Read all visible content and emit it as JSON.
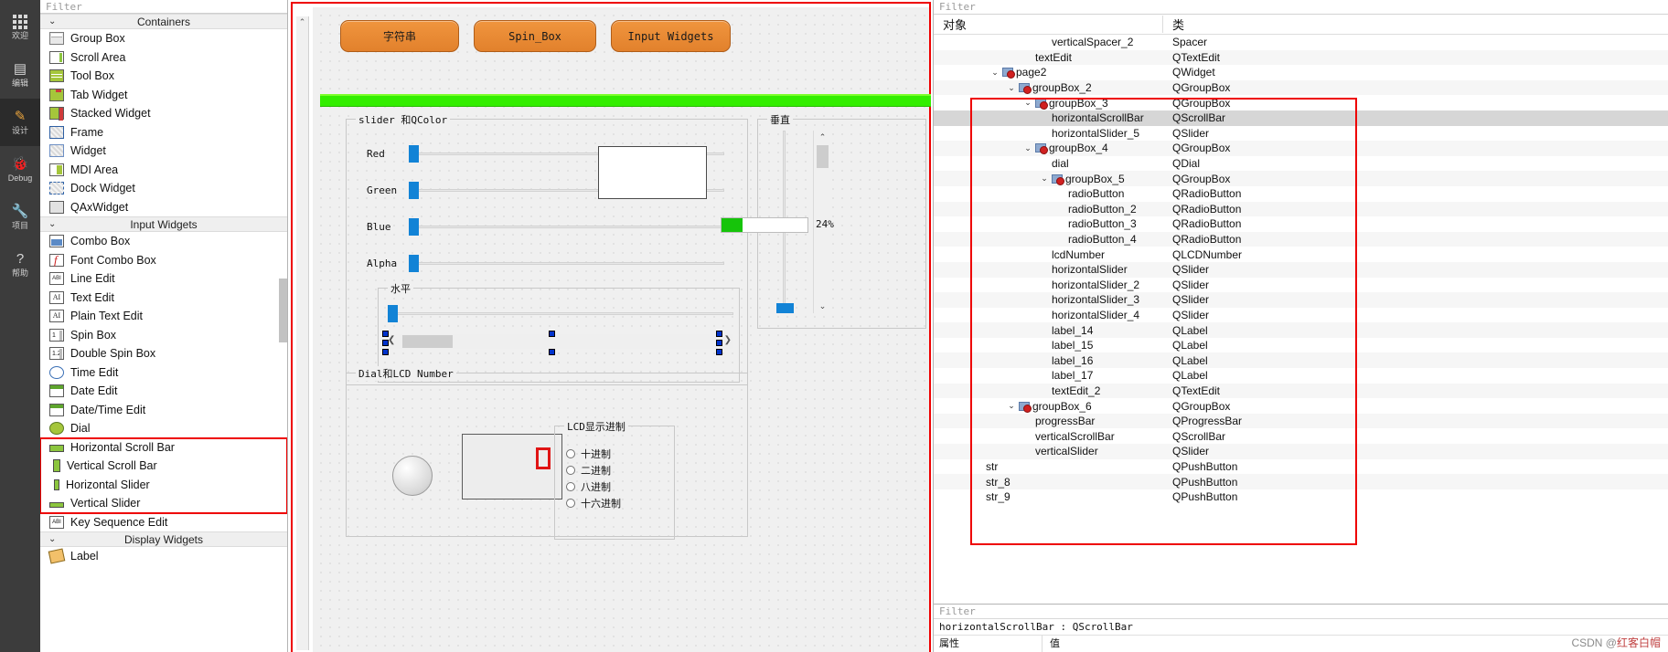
{
  "activity_bar": {
    "items": [
      {
        "icon": "grid-icon",
        "label": "欢迎",
        "active": false
      },
      {
        "icon": "document-icon",
        "label": "编辑",
        "active": false
      },
      {
        "icon": "pencil-icon",
        "label": "设计",
        "active": true
      },
      {
        "icon": "bug-icon",
        "label": "Debug",
        "active": false
      },
      {
        "icon": "wrench-icon",
        "label": "项目",
        "active": false
      },
      {
        "icon": "question-icon",
        "label": "帮助",
        "active": false
      }
    ]
  },
  "widget_box": {
    "filter_placeholder": "Filter",
    "groups": [
      {
        "title": "Containers",
        "items": [
          {
            "label": "Group Box",
            "icon": "groupbox-icon"
          },
          {
            "label": "Scroll Area",
            "icon": "scrollarea-icon"
          },
          {
            "label": "Tool Box",
            "icon": "toolbox-icon"
          },
          {
            "label": "Tab Widget",
            "icon": "tabwidget-icon"
          },
          {
            "label": "Stacked Widget",
            "icon": "stackedwidget-icon"
          },
          {
            "label": "Frame",
            "icon": "frame-icon"
          },
          {
            "label": "Widget",
            "icon": "widget-icon"
          },
          {
            "label": "MDI Area",
            "icon": "mdiarea-icon"
          },
          {
            "label": "Dock Widget",
            "icon": "dockwidget-icon"
          },
          {
            "label": "QAxWidget",
            "icon": "qaxwidget-icon"
          }
        ]
      },
      {
        "title": "Input Widgets",
        "items": [
          {
            "label": "Combo Box",
            "icon": "combobox-icon"
          },
          {
            "label": "Font Combo Box",
            "icon": "fontcombobox-icon"
          },
          {
            "label": "Line Edit",
            "icon": "lineedit-icon"
          },
          {
            "label": "Text Edit",
            "icon": "textedit-icon"
          },
          {
            "label": "Plain Text Edit",
            "icon": "plaintextedit-icon"
          },
          {
            "label": "Spin Box",
            "icon": "spinbox-icon"
          },
          {
            "label": "Double Spin Box",
            "icon": "doublespinbox-icon"
          },
          {
            "label": "Time Edit",
            "icon": "timeedit-icon"
          },
          {
            "label": "Date Edit",
            "icon": "dateedit-icon"
          },
          {
            "label": "Date/Time Edit",
            "icon": "datetimeedit-icon"
          },
          {
            "label": "Dial",
            "icon": "dial-icon"
          },
          {
            "label": "Horizontal Scroll Bar",
            "icon": "hscrollbar-icon",
            "highlighted": true
          },
          {
            "label": "Vertical Scroll Bar",
            "icon": "vscrollbar-icon",
            "highlighted": true
          },
          {
            "label": "Horizontal Slider",
            "icon": "hslider-icon",
            "highlighted": true
          },
          {
            "label": "Vertical Slider",
            "icon": "vslider-icon",
            "highlighted": true
          },
          {
            "label": "Key Sequence Edit",
            "icon": "keysequence-icon"
          }
        ]
      },
      {
        "title": "Display Widgets",
        "items": [
          {
            "label": "Label",
            "icon": "label-icon"
          }
        ]
      }
    ]
  },
  "canvas": {
    "buttons": [
      {
        "label": "字符串"
      },
      {
        "label": "Spin_Box"
      },
      {
        "label": "Input Widgets"
      }
    ],
    "group_slider_color": {
      "title": "slider 和QColor",
      "sliders": [
        {
          "label": "Red"
        },
        {
          "label": "Green"
        },
        {
          "label": "Blue"
        },
        {
          "label": "Alpha"
        }
      ],
      "color_preview": "#ffffff"
    },
    "group_horizontal": {
      "title": "水平"
    },
    "group_vertical": {
      "title": "垂直"
    },
    "progress": {
      "value": 24,
      "text": "24%",
      "fill_color": "#16c40a"
    },
    "group_dial_lcd": {
      "title": "Dial和LCD Number"
    },
    "group_lcd_base": {
      "title": "LCD显示进制",
      "options": [
        "十进制",
        "二进制",
        "八进制",
        "十六进制"
      ]
    }
  },
  "inspector": {
    "filter_placeholder": "Filter",
    "columns": {
      "name": "对象",
      "class": "类"
    },
    "rows": [
      {
        "name": "verticalSpacer_2",
        "class": "Spacer",
        "indent": 6,
        "chevron": "",
        "icon": false
      },
      {
        "name": "textEdit",
        "class": "QTextEdit",
        "indent": 5,
        "chevron": "",
        "icon": false
      },
      {
        "name": "page2",
        "class": "QWidget",
        "indent": 3,
        "chevron": "v",
        "icon": true
      },
      {
        "name": "groupBox_2",
        "class": "QGroupBox",
        "indent": 4,
        "chevron": "v",
        "icon": true
      },
      {
        "name": "groupBox_3",
        "class": "QGroupBox",
        "indent": 5,
        "chevron": "v",
        "icon": true
      },
      {
        "name": "horizontalScrollBar",
        "class": "QScrollBar",
        "indent": 6,
        "chevron": "",
        "icon": false,
        "selected": true
      },
      {
        "name": "horizontalSlider_5",
        "class": "QSlider",
        "indent": 6,
        "chevron": "",
        "icon": false
      },
      {
        "name": "groupBox_4",
        "class": "QGroupBox",
        "indent": 5,
        "chevron": "v",
        "icon": true
      },
      {
        "name": "dial",
        "class": "QDial",
        "indent": 6,
        "chevron": "",
        "icon": false
      },
      {
        "name": "groupBox_5",
        "class": "QGroupBox",
        "indent": 6,
        "chevron": "v",
        "icon": true
      },
      {
        "name": "radioButton",
        "class": "QRadioButton",
        "indent": 7,
        "chevron": "",
        "icon": false
      },
      {
        "name": "radioButton_2",
        "class": "QRadioButton",
        "indent": 7,
        "chevron": "",
        "icon": false
      },
      {
        "name": "radioButton_3",
        "class": "QRadioButton",
        "indent": 7,
        "chevron": "",
        "icon": false
      },
      {
        "name": "radioButton_4",
        "class": "QRadioButton",
        "indent": 7,
        "chevron": "",
        "icon": false
      },
      {
        "name": "lcdNumber",
        "class": "QLCDNumber",
        "indent": 6,
        "chevron": "",
        "icon": false
      },
      {
        "name": "horizontalSlider",
        "class": "QSlider",
        "indent": 6,
        "chevron": "",
        "icon": false
      },
      {
        "name": "horizontalSlider_2",
        "class": "QSlider",
        "indent": 6,
        "chevron": "",
        "icon": false
      },
      {
        "name": "horizontalSlider_3",
        "class": "QSlider",
        "indent": 6,
        "chevron": "",
        "icon": false
      },
      {
        "name": "horizontalSlider_4",
        "class": "QSlider",
        "indent": 6,
        "chevron": "",
        "icon": false
      },
      {
        "name": "label_14",
        "class": "QLabel",
        "indent": 6,
        "chevron": "",
        "icon": false
      },
      {
        "name": "label_15",
        "class": "QLabel",
        "indent": 6,
        "chevron": "",
        "icon": false
      },
      {
        "name": "label_16",
        "class": "QLabel",
        "indent": 6,
        "chevron": "",
        "icon": false
      },
      {
        "name": "label_17",
        "class": "QLabel",
        "indent": 6,
        "chevron": "",
        "icon": false
      },
      {
        "name": "textEdit_2",
        "class": "QTextEdit",
        "indent": 6,
        "chevron": "",
        "icon": false
      },
      {
        "name": "groupBox_6",
        "class": "QGroupBox",
        "indent": 4,
        "chevron": "v",
        "icon": true
      },
      {
        "name": "progressBar",
        "class": "QProgressBar",
        "indent": 5,
        "chevron": "",
        "icon": false
      },
      {
        "name": "verticalScrollBar",
        "class": "QScrollBar",
        "indent": 5,
        "chevron": "",
        "icon": false
      },
      {
        "name": "verticalSlider",
        "class": "QSlider",
        "indent": 5,
        "chevron": "",
        "icon": false
      },
      {
        "name": "str",
        "class": "QPushButton",
        "indent": 2,
        "chevron": "",
        "icon": false
      },
      {
        "name": "str_8",
        "class": "QPushButton",
        "indent": 2,
        "chevron": "",
        "icon": false
      },
      {
        "name": "str_9",
        "class": "QPushButton",
        "indent": 2,
        "chevron": "",
        "icon": false
      }
    ]
  },
  "property_editor": {
    "filter_placeholder": "Filter",
    "header": "horizontalScrollBar : QScrollBar",
    "col_property": "属性",
    "col_value": "值"
  },
  "watermark": {
    "prefix": "CSDN @",
    "name": "红客白帽"
  },
  "colors": {
    "accent_orange": "#e8852e",
    "selection_blue": "#0033cc",
    "slider_blue": "#1283d6",
    "green_bar": "#33ee00",
    "red_outline": "#ee0000"
  }
}
